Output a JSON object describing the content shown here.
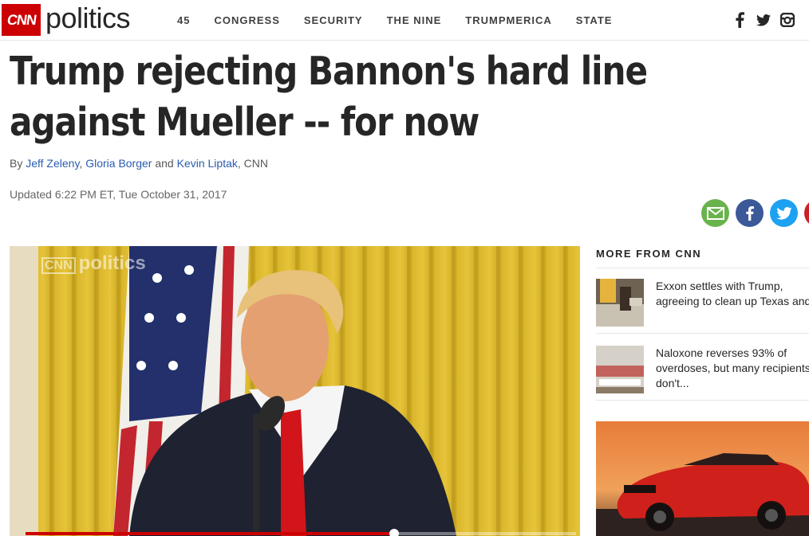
{
  "header": {
    "logo_text": "CNN",
    "section": "politics",
    "nav": [
      "45",
      "CONGRESS",
      "SECURITY",
      "THE NINE",
      "TRUMPMERICA",
      "STATE"
    ],
    "social": [
      "facebook-icon",
      "twitter-icon",
      "instagram-icon"
    ]
  },
  "article": {
    "headline": "Trump rejecting Bannon's hard line against Mueller -- for now",
    "by_prefix": "By",
    "authors": [
      "Jeff Zeleny",
      "Gloria Borger",
      "Kevin Liptak"
    ],
    "and": "and",
    "outlet": ", CNN",
    "updated": "Updated 6:22 PM ET, Tue October 31, 2017"
  },
  "share": [
    {
      "icon": "email-icon",
      "color": "#69b34c"
    },
    {
      "icon": "facebook-icon",
      "color": "#3b5998"
    },
    {
      "icon": "twitter-icon",
      "color": "#1da1f2"
    },
    {
      "icon": "pinterest-icon",
      "color": "#cb2027"
    }
  ],
  "video": {
    "watermark_logo": "CNN",
    "watermark_text": "politics",
    "progress": 0.67
  },
  "sidebar": {
    "title": "MORE FROM CNN",
    "stories": [
      {
        "text": "Exxon settles with Trump, agreeing to clean up Texas and"
      },
      {
        "text": "Naloxone reverses 93% of overdoses, but many recipients don't..."
      }
    ]
  },
  "colors": {
    "brand_red": "#cc0000",
    "link_blue": "#2a5db0"
  }
}
